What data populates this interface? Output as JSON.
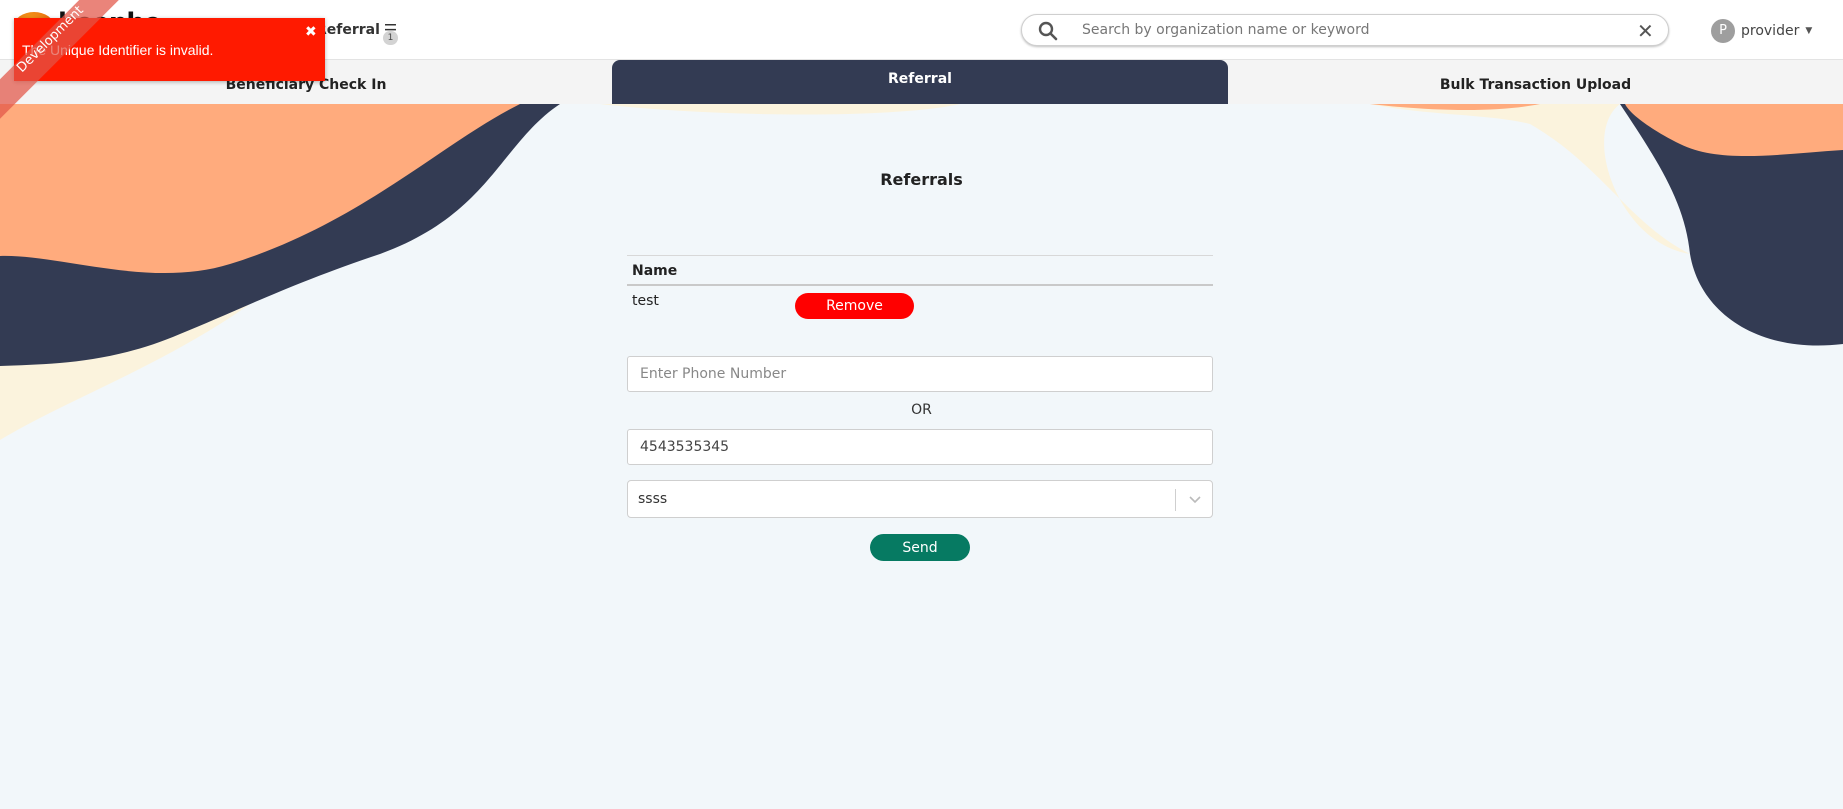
{
  "header": {
    "logo_text": "beenhe",
    "referral_label": "Referral",
    "referral_count": "1",
    "search": {
      "placeholder": "Search by organization name or keyword"
    },
    "user": {
      "initial": "P",
      "name": "provider"
    }
  },
  "tabs": [
    {
      "label": "Beneficiary Check In"
    },
    {
      "label": "Referral"
    },
    {
      "label": "Bulk Transaction Upload"
    }
  ],
  "main": {
    "title": "Referrals",
    "table": {
      "header": "Name",
      "rows": [
        {
          "name": "test",
          "action": "Remove"
        }
      ]
    },
    "phone": {
      "placeholder": "Enter Phone Number",
      "value": ""
    },
    "or_text": "OR",
    "identifier": {
      "value": "4543535345"
    },
    "select": {
      "value": "ssss"
    },
    "send_label": "Send"
  },
  "toast": {
    "message": "The Unique Identifier is invalid."
  },
  "ribbon": {
    "label": "Development"
  },
  "colors": {
    "navy": "#333b53",
    "peach": "#ffab7d",
    "cream": "#fbf3dd",
    "error_red": "#ff1a00",
    "remove_red": "#ff0000",
    "send_green": "#067a62"
  }
}
